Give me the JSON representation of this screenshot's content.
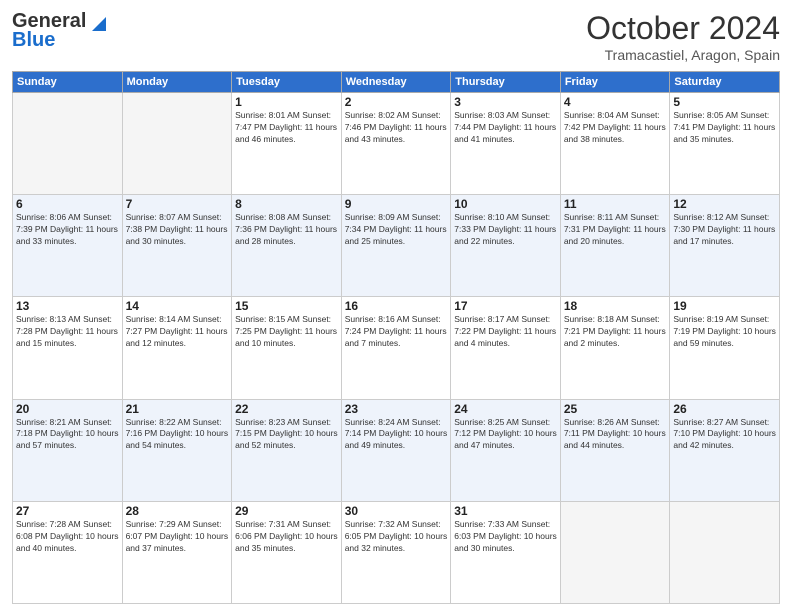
{
  "header": {
    "logo_general": "General",
    "logo_blue": "Blue",
    "month_title": "October 2024",
    "location": "Tramacastiel, Aragon, Spain"
  },
  "days_of_week": [
    "Sunday",
    "Monday",
    "Tuesday",
    "Wednesday",
    "Thursday",
    "Friday",
    "Saturday"
  ],
  "weeks": [
    [
      {
        "day": "",
        "info": ""
      },
      {
        "day": "",
        "info": ""
      },
      {
        "day": "1",
        "info": "Sunrise: 8:01 AM\nSunset: 7:47 PM\nDaylight: 11 hours and 46 minutes."
      },
      {
        "day": "2",
        "info": "Sunrise: 8:02 AM\nSunset: 7:46 PM\nDaylight: 11 hours and 43 minutes."
      },
      {
        "day": "3",
        "info": "Sunrise: 8:03 AM\nSunset: 7:44 PM\nDaylight: 11 hours and 41 minutes."
      },
      {
        "day": "4",
        "info": "Sunrise: 8:04 AM\nSunset: 7:42 PM\nDaylight: 11 hours and 38 minutes."
      },
      {
        "day": "5",
        "info": "Sunrise: 8:05 AM\nSunset: 7:41 PM\nDaylight: 11 hours and 35 minutes."
      }
    ],
    [
      {
        "day": "6",
        "info": "Sunrise: 8:06 AM\nSunset: 7:39 PM\nDaylight: 11 hours and 33 minutes."
      },
      {
        "day": "7",
        "info": "Sunrise: 8:07 AM\nSunset: 7:38 PM\nDaylight: 11 hours and 30 minutes."
      },
      {
        "day": "8",
        "info": "Sunrise: 8:08 AM\nSunset: 7:36 PM\nDaylight: 11 hours and 28 minutes."
      },
      {
        "day": "9",
        "info": "Sunrise: 8:09 AM\nSunset: 7:34 PM\nDaylight: 11 hours and 25 minutes."
      },
      {
        "day": "10",
        "info": "Sunrise: 8:10 AM\nSunset: 7:33 PM\nDaylight: 11 hours and 22 minutes."
      },
      {
        "day": "11",
        "info": "Sunrise: 8:11 AM\nSunset: 7:31 PM\nDaylight: 11 hours and 20 minutes."
      },
      {
        "day": "12",
        "info": "Sunrise: 8:12 AM\nSunset: 7:30 PM\nDaylight: 11 hours and 17 minutes."
      }
    ],
    [
      {
        "day": "13",
        "info": "Sunrise: 8:13 AM\nSunset: 7:28 PM\nDaylight: 11 hours and 15 minutes."
      },
      {
        "day": "14",
        "info": "Sunrise: 8:14 AM\nSunset: 7:27 PM\nDaylight: 11 hours and 12 minutes."
      },
      {
        "day": "15",
        "info": "Sunrise: 8:15 AM\nSunset: 7:25 PM\nDaylight: 11 hours and 10 minutes."
      },
      {
        "day": "16",
        "info": "Sunrise: 8:16 AM\nSunset: 7:24 PM\nDaylight: 11 hours and 7 minutes."
      },
      {
        "day": "17",
        "info": "Sunrise: 8:17 AM\nSunset: 7:22 PM\nDaylight: 11 hours and 4 minutes."
      },
      {
        "day": "18",
        "info": "Sunrise: 8:18 AM\nSunset: 7:21 PM\nDaylight: 11 hours and 2 minutes."
      },
      {
        "day": "19",
        "info": "Sunrise: 8:19 AM\nSunset: 7:19 PM\nDaylight: 10 hours and 59 minutes."
      }
    ],
    [
      {
        "day": "20",
        "info": "Sunrise: 8:21 AM\nSunset: 7:18 PM\nDaylight: 10 hours and 57 minutes."
      },
      {
        "day": "21",
        "info": "Sunrise: 8:22 AM\nSunset: 7:16 PM\nDaylight: 10 hours and 54 minutes."
      },
      {
        "day": "22",
        "info": "Sunrise: 8:23 AM\nSunset: 7:15 PM\nDaylight: 10 hours and 52 minutes."
      },
      {
        "day": "23",
        "info": "Sunrise: 8:24 AM\nSunset: 7:14 PM\nDaylight: 10 hours and 49 minutes."
      },
      {
        "day": "24",
        "info": "Sunrise: 8:25 AM\nSunset: 7:12 PM\nDaylight: 10 hours and 47 minutes."
      },
      {
        "day": "25",
        "info": "Sunrise: 8:26 AM\nSunset: 7:11 PM\nDaylight: 10 hours and 44 minutes."
      },
      {
        "day": "26",
        "info": "Sunrise: 8:27 AM\nSunset: 7:10 PM\nDaylight: 10 hours and 42 minutes."
      }
    ],
    [
      {
        "day": "27",
        "info": "Sunrise: 7:28 AM\nSunset: 6:08 PM\nDaylight: 10 hours and 40 minutes."
      },
      {
        "day": "28",
        "info": "Sunrise: 7:29 AM\nSunset: 6:07 PM\nDaylight: 10 hours and 37 minutes."
      },
      {
        "day": "29",
        "info": "Sunrise: 7:31 AM\nSunset: 6:06 PM\nDaylight: 10 hours and 35 minutes."
      },
      {
        "day": "30",
        "info": "Sunrise: 7:32 AM\nSunset: 6:05 PM\nDaylight: 10 hours and 32 minutes."
      },
      {
        "day": "31",
        "info": "Sunrise: 7:33 AM\nSunset: 6:03 PM\nDaylight: 10 hours and 30 minutes."
      },
      {
        "day": "",
        "info": ""
      },
      {
        "day": "",
        "info": ""
      }
    ]
  ]
}
